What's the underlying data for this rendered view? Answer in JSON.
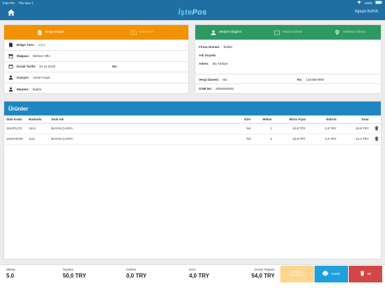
{
  "statusbar": {
    "time": "5:56 PM",
    "date": "Thu Nov 1",
    "battery": "100%"
  },
  "navbar": {
    "logo_a": "İşte",
    "logo_b": "Pos",
    "user": "Aysun KAYA"
  },
  "left_tabs": [
    {
      "label": "Belge Bilgisi"
    },
    {
      "label": "Ödemeler"
    }
  ],
  "doc": {
    "belge_turu_label": "Belge Türü:",
    "belge_turu": "Satış",
    "magaza_label": "Mağaza:",
    "magaza": "Merkez Ofis",
    "evrak_label": "Evrak Tarihi:",
    "evrak": "01.11.2018",
    "no_label": "No:",
    "kasiyer_label": "Kasiyer:",
    "kasiyer": "Aysun Kaya",
    "musteri_label": "Müşteri:",
    "musteri": "blabla"
  },
  "right_tabs": [
    {
      "label": "Müşteri Bilgileri"
    },
    {
      "label": "Fatura Adresi"
    },
    {
      "label": "Teslimat Adresi"
    }
  ],
  "customer": {
    "firma_label": "Firma Ünvanı:",
    "firma": "blabla",
    "adsoyad_label": "Adı Soyadı:",
    "adsoyad": "",
    "adres_label": "Adres:",
    "adres": "bla  Türkiye",
    "vergi_label": "Vergi Dairesi:",
    "vergi": "bla",
    "no_label": "No:",
    "no": "1234567890",
    "gsm_label": "GSM No:",
    "gsm": "5555555555"
  },
  "products": {
    "title": "Ürünler",
    "columns": [
      "Stok Kodu",
      "Barkodu",
      "Stok Adı",
      "KDV",
      "Miktar",
      "Birim Fiyat",
      "İndirim",
      "Tutar"
    ],
    "rows": [
      {
        "kod": "161JF1272",
        "barkod": "1212",
        "ad": "BAYAN ÇANTA",
        "kdv": "%8",
        "miktar": "1",
        "fiyat": "10,8 TRY",
        "indirim": "0,0 TRY",
        "tutar": "10,8 TRY"
      },
      {
        "kod": "161DY6700",
        "barkod": "1111",
        "ad": "BAYAN ÇANTA",
        "kdv": "%8",
        "miktar": "4",
        "fiyat": "10,8 TRY",
        "indirim": "0,0 TRY",
        "tutar": "43,2 TRY"
      }
    ]
  },
  "footer": {
    "miktar_label": "Miktar",
    "miktar": "5.0",
    "toplam_label": "Toplam",
    "toplam": "50,0 TRY",
    "indirim_label": "İndirim",
    "indirim": "0,0 TRY",
    "kdv_label": "KDV",
    "kdv": "4,0 TRY",
    "genel_label": "Genel Toplam",
    "genel": "54,0 TRY",
    "save_label_1": "Belgeyi",
    "save_label_2": "Onaylama",
    "print_label": "Yazdır",
    "delete_label": "Sil"
  },
  "colors": {
    "header": "#1f6fa3",
    "orange": "#f39200",
    "green": "#2e9a63",
    "blue": "#1f86c0",
    "delete": "#d24646"
  }
}
